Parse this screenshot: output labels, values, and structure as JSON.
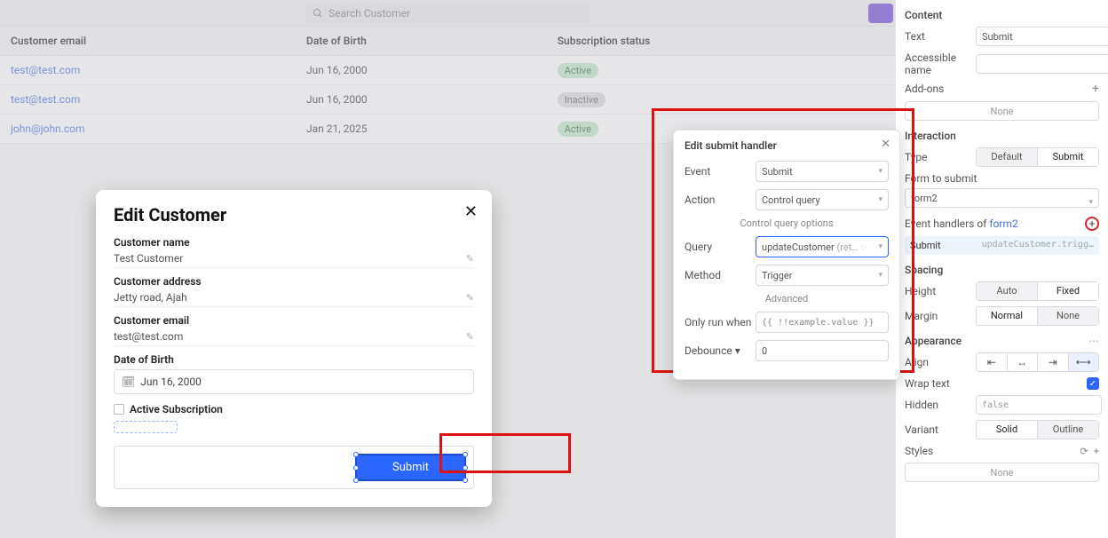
{
  "search": {
    "placeholder": "Search Customer"
  },
  "table": {
    "headers": [
      "Customer email",
      "Date of Birth",
      "Subscription status"
    ],
    "rows": [
      {
        "email": "test@test.com",
        "dob": "Jun 16, 2000",
        "status": "Active",
        "status_kind": "active"
      },
      {
        "email": "test@test.com",
        "dob": "Jun 16, 2000",
        "status": "Inactive",
        "status_kind": "inactive"
      },
      {
        "email": "john@john.com",
        "dob": "Jan 21, 2025",
        "status": "Active",
        "status_kind": "active"
      }
    ]
  },
  "modal": {
    "title": "Edit Customer",
    "name_label": "Customer name",
    "name_value": "Test Customer",
    "address_label": "Customer address",
    "address_value": "Jetty road, Ajah",
    "email_label": "Customer email",
    "email_value": "test@test.com",
    "dob_label": "Date of Birth",
    "dob_value": "Jun 16, 2000",
    "active_label": "Active Subscription",
    "submit_label": "Submit"
  },
  "popup": {
    "title": "Edit submit handler",
    "event_label": "Event",
    "event_value": "Submit",
    "action_label": "Action",
    "action_value": "Control query",
    "options_divider": "Control query options",
    "query_label": "Query",
    "query_value": "updateCustomer",
    "query_hint": "(ret…",
    "method_label": "Method",
    "method_value": "Trigger",
    "advanced_divider": "Advanced",
    "onlyrun_label": "Only run when",
    "onlyrun_placeholder": "{{ !!example.value }}",
    "debounce_label": "Debounce",
    "debounce_value": "0"
  },
  "panel": {
    "content_header": "Content",
    "text_label": "Text",
    "text_value": "Submit",
    "accessible_label": "Accessible name",
    "accessible_value": "",
    "addons_label": "Add-ons",
    "addons_none": "None",
    "interaction_header": "Interaction",
    "type_label": "Type",
    "type_opts": [
      "Default",
      "Submit"
    ],
    "type_sel": 1,
    "form_label": "Form to submit",
    "form_value": "form2",
    "handlers_label": "Event handlers of",
    "handlers_form": "form2",
    "handler_row_label": "Submit",
    "handler_row_val": "updateCustomer.trigg…",
    "spacing_header": "Spacing",
    "height_label": "Height",
    "height_opts": [
      "Auto",
      "Fixed"
    ],
    "height_sel": 1,
    "margin_label": "Margin",
    "margin_opts": [
      "Normal",
      "None"
    ],
    "margin_sel": 0,
    "appearance_header": "Appearance",
    "align_label": "Align",
    "wrap_label": "Wrap text",
    "wrap_value": true,
    "hidden_label": "Hidden",
    "hidden_value": "false",
    "variant_label": "Variant",
    "variant_opts": [
      "Solid",
      "Outline"
    ],
    "variant_sel": 0,
    "styles_label": "Styles",
    "styles_none": "None"
  }
}
